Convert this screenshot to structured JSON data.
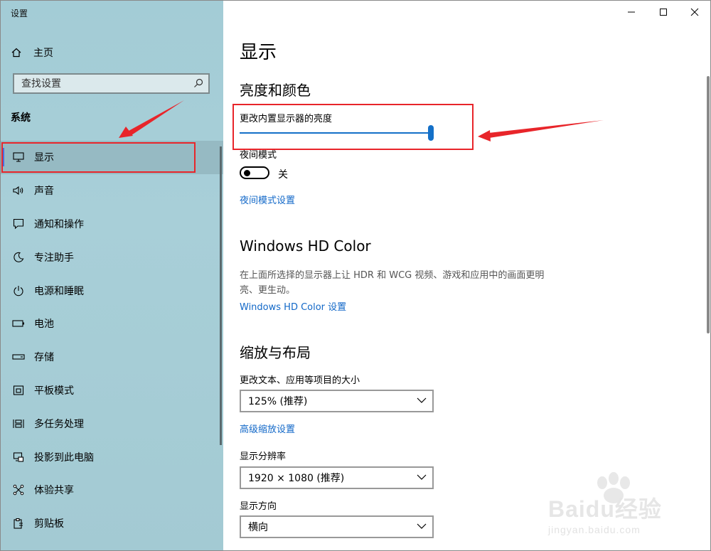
{
  "window": {
    "title": "设置"
  },
  "controls": {
    "minimize": "minimize",
    "maximize": "maximize",
    "close": "close"
  },
  "sidebar": {
    "home_label": "主页",
    "search_placeholder": "查找设置",
    "section": "系统",
    "items": [
      {
        "label": "显示",
        "icon": "monitor-icon",
        "active": true
      },
      {
        "label": "声音",
        "icon": "speaker-icon"
      },
      {
        "label": "通知和操作",
        "icon": "notification-icon"
      },
      {
        "label": "专注助手",
        "icon": "moon-icon"
      },
      {
        "label": "电源和睡眠",
        "icon": "power-icon"
      },
      {
        "label": "电池",
        "icon": "battery-icon"
      },
      {
        "label": "存储",
        "icon": "storage-icon"
      },
      {
        "label": "平板模式",
        "icon": "tablet-icon"
      },
      {
        "label": "多任务处理",
        "icon": "multitask-icon"
      },
      {
        "label": "投影到此电脑",
        "icon": "project-icon"
      },
      {
        "label": "体验共享",
        "icon": "share-icon"
      },
      {
        "label": "剪贴板",
        "icon": "clipboard-icon"
      }
    ]
  },
  "main": {
    "title": "显示",
    "brightness": {
      "heading": "亮度和颜色",
      "slider_label": "更改内置显示器的亮度",
      "slider_value": 1.0
    },
    "night_mode": {
      "label": "夜间模式",
      "state_text": "关",
      "settings_link": "夜间模式设置"
    },
    "hd_color": {
      "heading": "Windows HD Color",
      "description": "在上面所选择的显示器上让 HDR 和 WCG 视频、游戏和应用中的画面更明亮、更生动。",
      "link": "Windows HD Color 设置"
    },
    "layout": {
      "heading": "缩放与布局",
      "scale_label": "更改文本、应用等项目的大小",
      "scale_value": "125% (推荐)",
      "advanced_link": "高级缩放设置",
      "resolution_label": "显示分辨率",
      "resolution_value": "1920 × 1080 (推荐)",
      "orientation_label": "显示方向",
      "orientation_value": "横向"
    }
  },
  "watermark": {
    "brand": "Baidu经验",
    "url": "jingyan.baidu.com"
  },
  "colors": {
    "accent": "#1470c8",
    "annotation": "#e8252a",
    "sidebar_bg": "#a6cdd6"
  }
}
